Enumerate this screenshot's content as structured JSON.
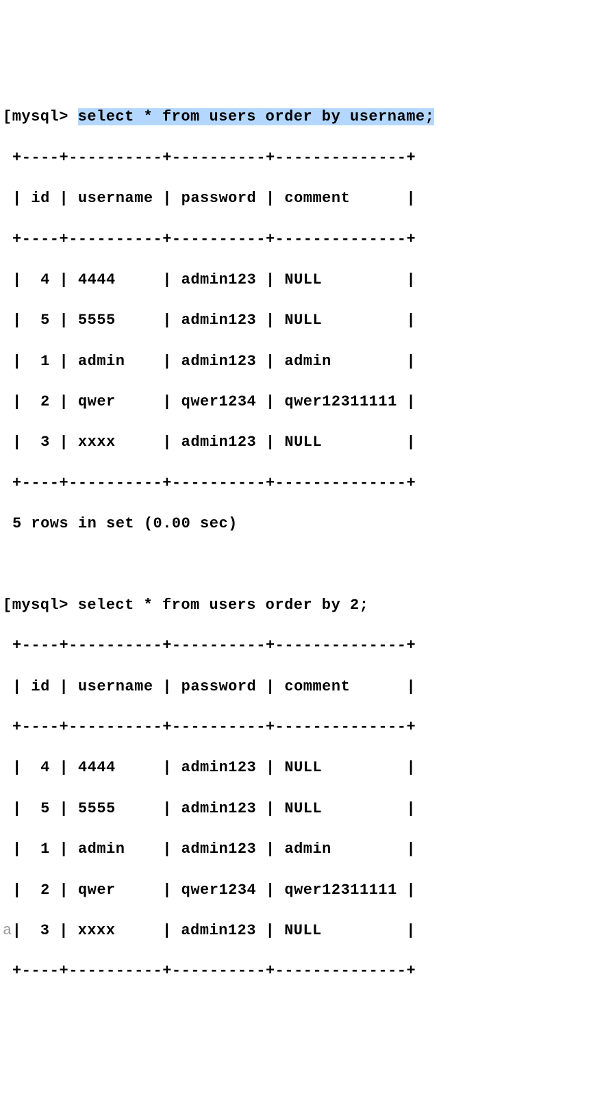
{
  "query1": {
    "prompt_bracket": "[",
    "prompt": "mysql> ",
    "command": "select * from users order by username;",
    "border_top": "+----+----------+----------+--------------+",
    "header": "| id | username | password | comment      |",
    "border_mid": "+----+----------+----------+--------------+",
    "rows": [
      "|  4 | 4444     | admin123 | NULL         |",
      "|  5 | 5555     | admin123 | NULL         |",
      "|  1 | admin    | admin123 | admin        |",
      "|  2 | qwer     | qwer1234 | qwer12311111 |",
      "|  3 | xxxx     | admin123 | NULL         |"
    ],
    "border_bot": "+----+----------+----------+--------------+",
    "status": "5 rows in set (0.00 sec)"
  },
  "query2": {
    "prompt_bracket": "[",
    "prompt": "mysql> ",
    "command": "select * from users order by 2;",
    "border_top": "+----+----------+----------+--------------+",
    "header": "| id | username | password | comment      |",
    "border_mid": "+----+----------+----------+--------------+",
    "rows": [
      "|  4 | 4444     | admin123 | NULL         |",
      "|  5 | 5555     | admin123 | NULL         |",
      "|  1 | admin    | admin123 | admin        |",
      "|  2 | qwer     | qwer1234 | qwer12311111 |",
      "|  3 | xxxx     | admin123 | NULL         |"
    ],
    "border_bot": "+----+----------+----------+--------------+",
    "gutter_char": "a"
  }
}
